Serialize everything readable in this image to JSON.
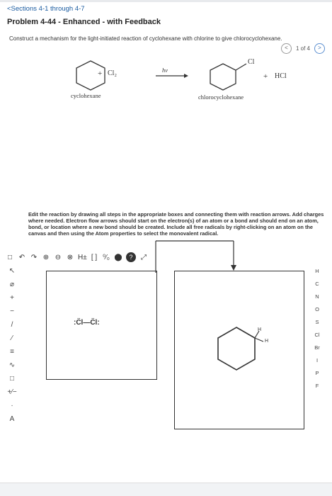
{
  "nav": {
    "back_link": "<Sections 4-1 through 4-7"
  },
  "problem": {
    "title": "Problem 4-44 - Enhanced - with Feedback"
  },
  "pager": {
    "text": "1 of 4",
    "prev": "<",
    "next": ">"
  },
  "prompt": "Construct a mechanism for the light-initiated reaction of cyclohexane with chlorine to give chlorocyclohexane.",
  "reaction": {
    "plus1": "+",
    "reagent": "Cl₂",
    "condition": "hv",
    "plus2": "+",
    "product2": "HCl",
    "reactant_name": "cyclohexane",
    "product_name": "chlorocyclohexane",
    "cl_label": "Cl"
  },
  "instructions": "Edit the reaction by drawing all steps in the appropriate boxes and connecting them with reaction arrows. Add charges where needed. Electron flow arrows should start on the electron(s) of an atom or a bond and should end on an atom, bond, or location where a new bond should be created. Include all free radicals by right-clicking on an atom on the canvas and then using the Atom properties to select the monovalent radical.",
  "toolbar": {
    "items": [
      "□",
      "↶",
      "↷",
      "⊕",
      "⊖",
      "⊗",
      "H±",
      "[ ]",
      "⁰⁄₀",
      "⬤",
      "?",
      "⤢"
    ]
  },
  "left_tools": [
    "↖",
    "⌀",
    "+",
    "−",
    "/",
    "∕",
    "≡",
    "∿",
    "□",
    "+⁄−",
    "·",
    "A"
  ],
  "elements": [
    "H",
    "C",
    "N",
    "O",
    "S",
    "Cl",
    "Br",
    "I",
    "P",
    "F"
  ],
  "canvas": {
    "box1_molecule": ":C̈l—C̈l:",
    "h1": "H",
    "h2": "H"
  }
}
